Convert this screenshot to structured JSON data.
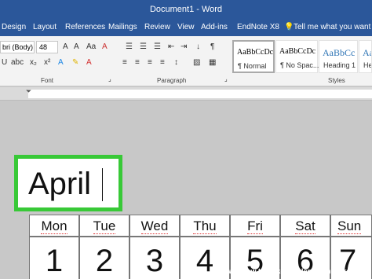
{
  "window": {
    "title": "Document1 - Word"
  },
  "ribbon_tabs": [
    "Design",
    "Layout",
    "References",
    "Mailings",
    "Review",
    "View",
    "Add-ins",
    "EndNote X8"
  ],
  "tell_me": "Tell me what you want to d",
  "font": {
    "name": "bri (Body)",
    "size": "48"
  },
  "groups": {
    "font": "Font",
    "paragraph": "Paragraph",
    "styles": "Styles"
  },
  "styles": [
    {
      "sample": "AaBbCcDc",
      "name": "¶ Normal"
    },
    {
      "sample": "AaBbCcDc",
      "name": "¶ No Spac..."
    },
    {
      "sample": "AaBbCc",
      "name": "Heading 1"
    },
    {
      "sample": "AaBb",
      "name": "Hea"
    }
  ],
  "document": {
    "month": "April"
  },
  "calendar": {
    "days": [
      "Mon",
      "Tue",
      "Wed",
      "Thu",
      "Fri",
      "Sat",
      "Sun"
    ],
    "dates": [
      "1",
      "2",
      "3",
      "4",
      "5",
      "6",
      "7"
    ]
  },
  "watermark": "wiki How to Make a Calendar in Word"
}
